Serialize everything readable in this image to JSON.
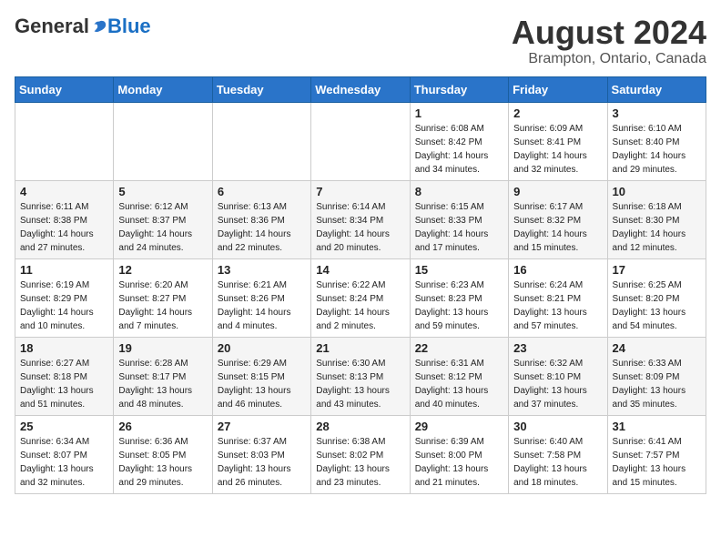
{
  "header": {
    "logo_general": "General",
    "logo_blue": "Blue",
    "month_title": "August 2024",
    "location": "Brampton, Ontario, Canada"
  },
  "days_of_week": [
    "Sunday",
    "Monday",
    "Tuesday",
    "Wednesday",
    "Thursday",
    "Friday",
    "Saturday"
  ],
  "weeks": [
    [
      {
        "day": "",
        "info": ""
      },
      {
        "day": "",
        "info": ""
      },
      {
        "day": "",
        "info": ""
      },
      {
        "day": "",
        "info": ""
      },
      {
        "day": "1",
        "info": "Sunrise: 6:08 AM\nSunset: 8:42 PM\nDaylight: 14 hours\nand 34 minutes."
      },
      {
        "day": "2",
        "info": "Sunrise: 6:09 AM\nSunset: 8:41 PM\nDaylight: 14 hours\nand 32 minutes."
      },
      {
        "day": "3",
        "info": "Sunrise: 6:10 AM\nSunset: 8:40 PM\nDaylight: 14 hours\nand 29 minutes."
      }
    ],
    [
      {
        "day": "4",
        "info": "Sunrise: 6:11 AM\nSunset: 8:38 PM\nDaylight: 14 hours\nand 27 minutes."
      },
      {
        "day": "5",
        "info": "Sunrise: 6:12 AM\nSunset: 8:37 PM\nDaylight: 14 hours\nand 24 minutes."
      },
      {
        "day": "6",
        "info": "Sunrise: 6:13 AM\nSunset: 8:36 PM\nDaylight: 14 hours\nand 22 minutes."
      },
      {
        "day": "7",
        "info": "Sunrise: 6:14 AM\nSunset: 8:34 PM\nDaylight: 14 hours\nand 20 minutes."
      },
      {
        "day": "8",
        "info": "Sunrise: 6:15 AM\nSunset: 8:33 PM\nDaylight: 14 hours\nand 17 minutes."
      },
      {
        "day": "9",
        "info": "Sunrise: 6:17 AM\nSunset: 8:32 PM\nDaylight: 14 hours\nand 15 minutes."
      },
      {
        "day": "10",
        "info": "Sunrise: 6:18 AM\nSunset: 8:30 PM\nDaylight: 14 hours\nand 12 minutes."
      }
    ],
    [
      {
        "day": "11",
        "info": "Sunrise: 6:19 AM\nSunset: 8:29 PM\nDaylight: 14 hours\nand 10 minutes."
      },
      {
        "day": "12",
        "info": "Sunrise: 6:20 AM\nSunset: 8:27 PM\nDaylight: 14 hours\nand 7 minutes."
      },
      {
        "day": "13",
        "info": "Sunrise: 6:21 AM\nSunset: 8:26 PM\nDaylight: 14 hours\nand 4 minutes."
      },
      {
        "day": "14",
        "info": "Sunrise: 6:22 AM\nSunset: 8:24 PM\nDaylight: 14 hours\nand 2 minutes."
      },
      {
        "day": "15",
        "info": "Sunrise: 6:23 AM\nSunset: 8:23 PM\nDaylight: 13 hours\nand 59 minutes."
      },
      {
        "day": "16",
        "info": "Sunrise: 6:24 AM\nSunset: 8:21 PM\nDaylight: 13 hours\nand 57 minutes."
      },
      {
        "day": "17",
        "info": "Sunrise: 6:25 AM\nSunset: 8:20 PM\nDaylight: 13 hours\nand 54 minutes."
      }
    ],
    [
      {
        "day": "18",
        "info": "Sunrise: 6:27 AM\nSunset: 8:18 PM\nDaylight: 13 hours\nand 51 minutes."
      },
      {
        "day": "19",
        "info": "Sunrise: 6:28 AM\nSunset: 8:17 PM\nDaylight: 13 hours\nand 48 minutes."
      },
      {
        "day": "20",
        "info": "Sunrise: 6:29 AM\nSunset: 8:15 PM\nDaylight: 13 hours\nand 46 minutes."
      },
      {
        "day": "21",
        "info": "Sunrise: 6:30 AM\nSunset: 8:13 PM\nDaylight: 13 hours\nand 43 minutes."
      },
      {
        "day": "22",
        "info": "Sunrise: 6:31 AM\nSunset: 8:12 PM\nDaylight: 13 hours\nand 40 minutes."
      },
      {
        "day": "23",
        "info": "Sunrise: 6:32 AM\nSunset: 8:10 PM\nDaylight: 13 hours\nand 37 minutes."
      },
      {
        "day": "24",
        "info": "Sunrise: 6:33 AM\nSunset: 8:09 PM\nDaylight: 13 hours\nand 35 minutes."
      }
    ],
    [
      {
        "day": "25",
        "info": "Sunrise: 6:34 AM\nSunset: 8:07 PM\nDaylight: 13 hours\nand 32 minutes."
      },
      {
        "day": "26",
        "info": "Sunrise: 6:36 AM\nSunset: 8:05 PM\nDaylight: 13 hours\nand 29 minutes."
      },
      {
        "day": "27",
        "info": "Sunrise: 6:37 AM\nSunset: 8:03 PM\nDaylight: 13 hours\nand 26 minutes."
      },
      {
        "day": "28",
        "info": "Sunrise: 6:38 AM\nSunset: 8:02 PM\nDaylight: 13 hours\nand 23 minutes."
      },
      {
        "day": "29",
        "info": "Sunrise: 6:39 AM\nSunset: 8:00 PM\nDaylight: 13 hours\nand 21 minutes."
      },
      {
        "day": "30",
        "info": "Sunrise: 6:40 AM\nSunset: 7:58 PM\nDaylight: 13 hours\nand 18 minutes."
      },
      {
        "day": "31",
        "info": "Sunrise: 6:41 AM\nSunset: 7:57 PM\nDaylight: 13 hours\nand 15 minutes."
      }
    ]
  ]
}
